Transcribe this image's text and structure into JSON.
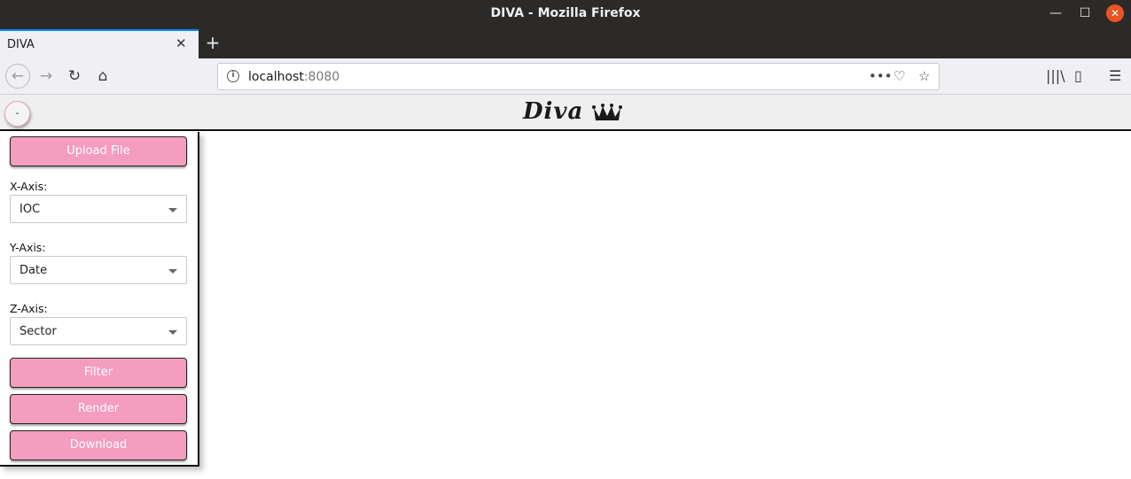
{
  "window": {
    "title": "DIVA - Mozilla Firefox",
    "controls": {
      "minimize": "—",
      "maximize": "☐",
      "close": "✕"
    }
  },
  "tabs": [
    {
      "label": "DIVA",
      "close": "✕"
    }
  ],
  "newtab_label": "+",
  "nav": {
    "back": "←",
    "forward": "→",
    "reload": "↻",
    "home": "⌂",
    "url_host": "localhost",
    "url_port": ":8080",
    "more": "•••",
    "pocket": "♡",
    "star": "☆",
    "library": "|||\\",
    "sidebar": "▯",
    "menu": "☰"
  },
  "app": {
    "toggle_label": "-",
    "logo_text": "Diva"
  },
  "panel": {
    "upload_label": "Upload File",
    "x_axis": {
      "label": "X-Axis:",
      "value": "IOC"
    },
    "y_axis": {
      "label": "Y-Axis:",
      "value": "Date"
    },
    "z_axis": {
      "label": "Z-Axis:",
      "value": "Sector"
    },
    "filter_label": "Filter",
    "render_label": "Render",
    "download_label": "Download"
  },
  "colors": {
    "accent_pink": "#f49dbf",
    "titlebar": "#2b2a29",
    "close_button": "#e95420"
  }
}
